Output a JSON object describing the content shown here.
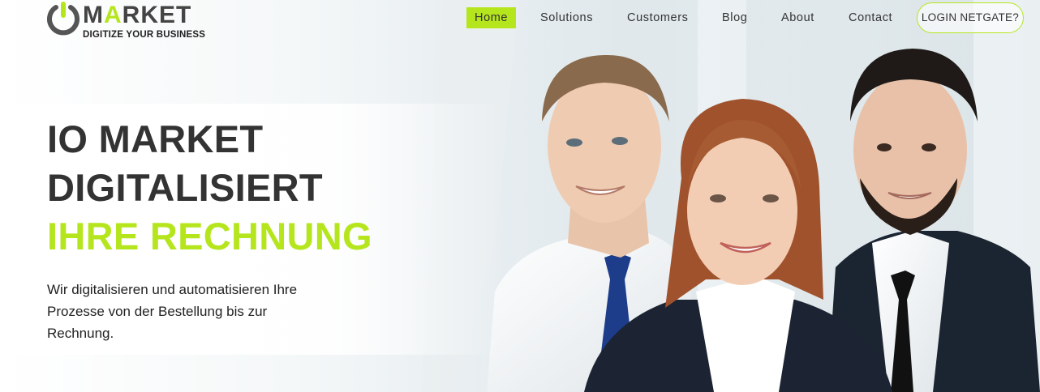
{
  "brand": {
    "name_prefix": "M",
    "name_green": "A",
    "name_suffix": "RKET",
    "tagline": "DIGITIZE YOUR BUSINESS"
  },
  "nav": {
    "items": [
      {
        "label": "Home",
        "active": true
      },
      {
        "label": "Solutions",
        "active": false
      },
      {
        "label": "Customers",
        "active": false
      },
      {
        "label": "Blog",
        "active": false
      },
      {
        "label": "About",
        "active": false
      },
      {
        "label": "Contact",
        "active": false
      }
    ],
    "login_label": "LOGIN NETGATE?"
  },
  "hero": {
    "headline_line1": "IO MARKET",
    "headline_line2": "DIGITALISIERT",
    "headline_line3": "IHRE RECHNUNG",
    "description": "Wir digitalisieren und automatisieren Ihre Prozesse von der Bestellung bis zur Rechnung."
  },
  "colors": {
    "accent": "#b5e61d",
    "text_dark": "#333333"
  },
  "icons": {
    "logo": "power-icon"
  }
}
